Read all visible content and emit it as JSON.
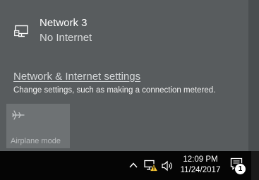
{
  "network": {
    "name": "Network  3",
    "status": "No Internet",
    "icon": "network-desktop-icon"
  },
  "settings": {
    "link_text": "Network & Internet settings",
    "description": "Change settings, such as making a connection metered."
  },
  "quick_actions": {
    "airplane_mode": {
      "label": "Airplane mode",
      "icon": "airplane-icon",
      "state": "off"
    }
  },
  "taskbar": {
    "time": "12:09 PM",
    "date": "11/24/2017",
    "notification_count": "1",
    "tray_icons": [
      "chevron-up-icon",
      "network-warning-icon",
      "volume-icon",
      "action-center-icon"
    ]
  },
  "colors": {
    "flyout_bg": "#585c5e",
    "tile_bg": "#6e7274",
    "taskbar_bg": "#050505",
    "warning": "#f6c533"
  }
}
